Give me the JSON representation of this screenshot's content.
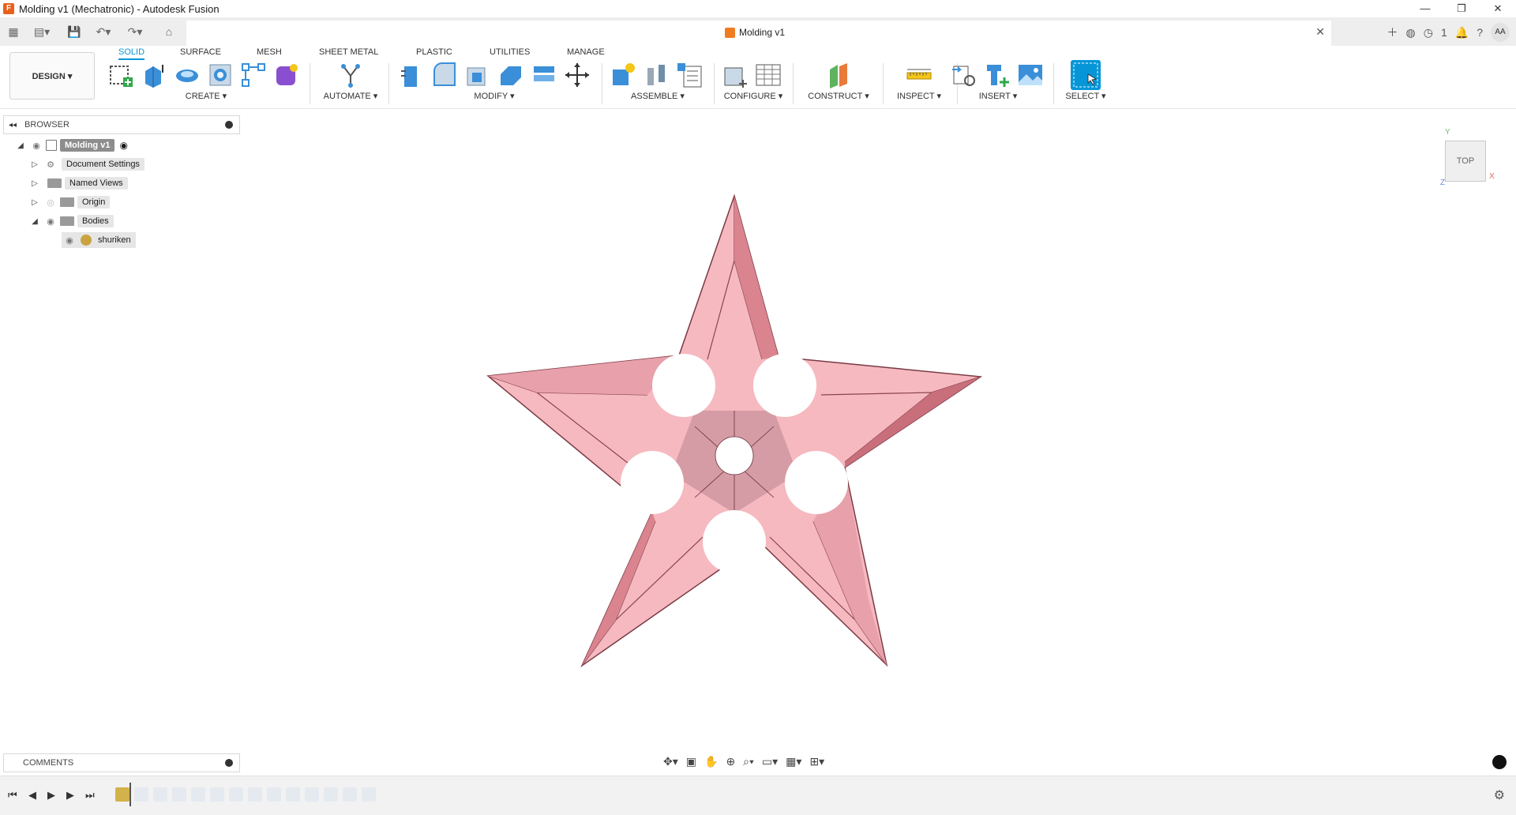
{
  "window": {
    "title": "Molding v1 (Mechatronic) - Autodesk Fusion",
    "logo_letter": "F",
    "controls": [
      "—",
      "❐",
      "✕"
    ]
  },
  "document_tab": {
    "name": "Molding v1"
  },
  "workspace": {
    "label": "DESIGN ▾"
  },
  "ribbon_tabs": [
    "SOLID",
    "SURFACE",
    "MESH",
    "SHEET METAL",
    "PLASTIC",
    "UTILITIES",
    "MANAGE"
  ],
  "ribbon_groups": {
    "create": "CREATE ▾",
    "automate": "AUTOMATE ▾",
    "modify": "MODIFY ▾",
    "assemble": "ASSEMBLE ▾",
    "configure": "CONFIGURE ▾",
    "construct": "CONSTRUCT ▾",
    "inspect": "INSPECT ▾",
    "insert": "INSERT ▾",
    "select": "SELECT ▾"
  },
  "browser": {
    "title": "BROWSER",
    "root": "Molding v1",
    "items": [
      "Document Settings",
      "Named Views",
      "Origin",
      "Bodies"
    ],
    "body": "shuriken"
  },
  "comments": {
    "title": "COMMENTS"
  },
  "view_cube": {
    "face": "TOP",
    "axis_x": "X",
    "axis_y": "Y",
    "axis_z": "Z"
  },
  "user": {
    "initials": "AA"
  },
  "notifications": {
    "count": "1"
  },
  "colors": {
    "accent": "#0696d7",
    "body_fill": "#f6b9c0",
    "body_edge": "#7a3a44"
  }
}
